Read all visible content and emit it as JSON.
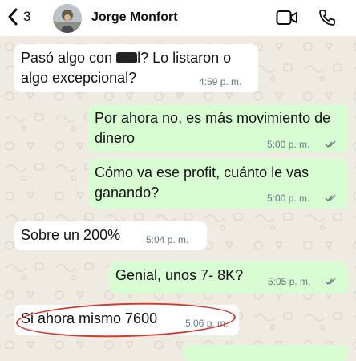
{
  "header": {
    "back_count": "3",
    "contact_name": "Jorge Monfort"
  },
  "messages": [
    {
      "direction": "in",
      "text_before": "Pasó algo con ",
      "text_after": "l? Lo listaron o algo excepcional?",
      "time": "4:59 p. m."
    },
    {
      "direction": "out",
      "text": "Por ahora no, es más movimiento de dinero",
      "time": "5:00 p. m."
    },
    {
      "direction": "out",
      "text": "Cómo va ese profit, cuánto le vas ganando?",
      "time": "5:00 p. m."
    },
    {
      "direction": "in",
      "text": "Sobre un 200%",
      "time": "5:04 p. m."
    },
    {
      "direction": "out",
      "text": "Genial, unos 7- 8K?",
      "time": "5:05 p. m."
    },
    {
      "direction": "in",
      "text": "Si ahora mismo 7600",
      "time": "5:06 p. m."
    }
  ],
  "colors": {
    "incoming_bubble": "#ffffff",
    "outgoing_bubble": "#d9fdd3",
    "chat_background": "#efeae2",
    "annotation_circle": "#d33a2f",
    "read_ticks": "#667781"
  },
  "icons": {
    "back": "chevron-left-icon",
    "video": "video-camera-icon",
    "call": "phone-icon"
  }
}
